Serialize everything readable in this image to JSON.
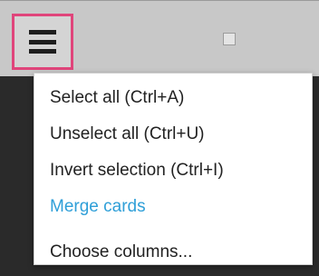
{
  "toolbar": {
    "menu_icon": "hamburger-menu-icon",
    "highlight_color": "#e0457b"
  },
  "menu": {
    "items": [
      {
        "label": "Select all (Ctrl+A)",
        "style": "normal"
      },
      {
        "label": "Unselect all (Ctrl+U)",
        "style": "normal"
      },
      {
        "label": "Invert selection (Ctrl+I)",
        "style": "normal"
      },
      {
        "label": "Merge cards",
        "style": "link",
        "color": "#2f9fd8"
      },
      {
        "label": "Choose columns...",
        "style": "normal"
      }
    ]
  }
}
